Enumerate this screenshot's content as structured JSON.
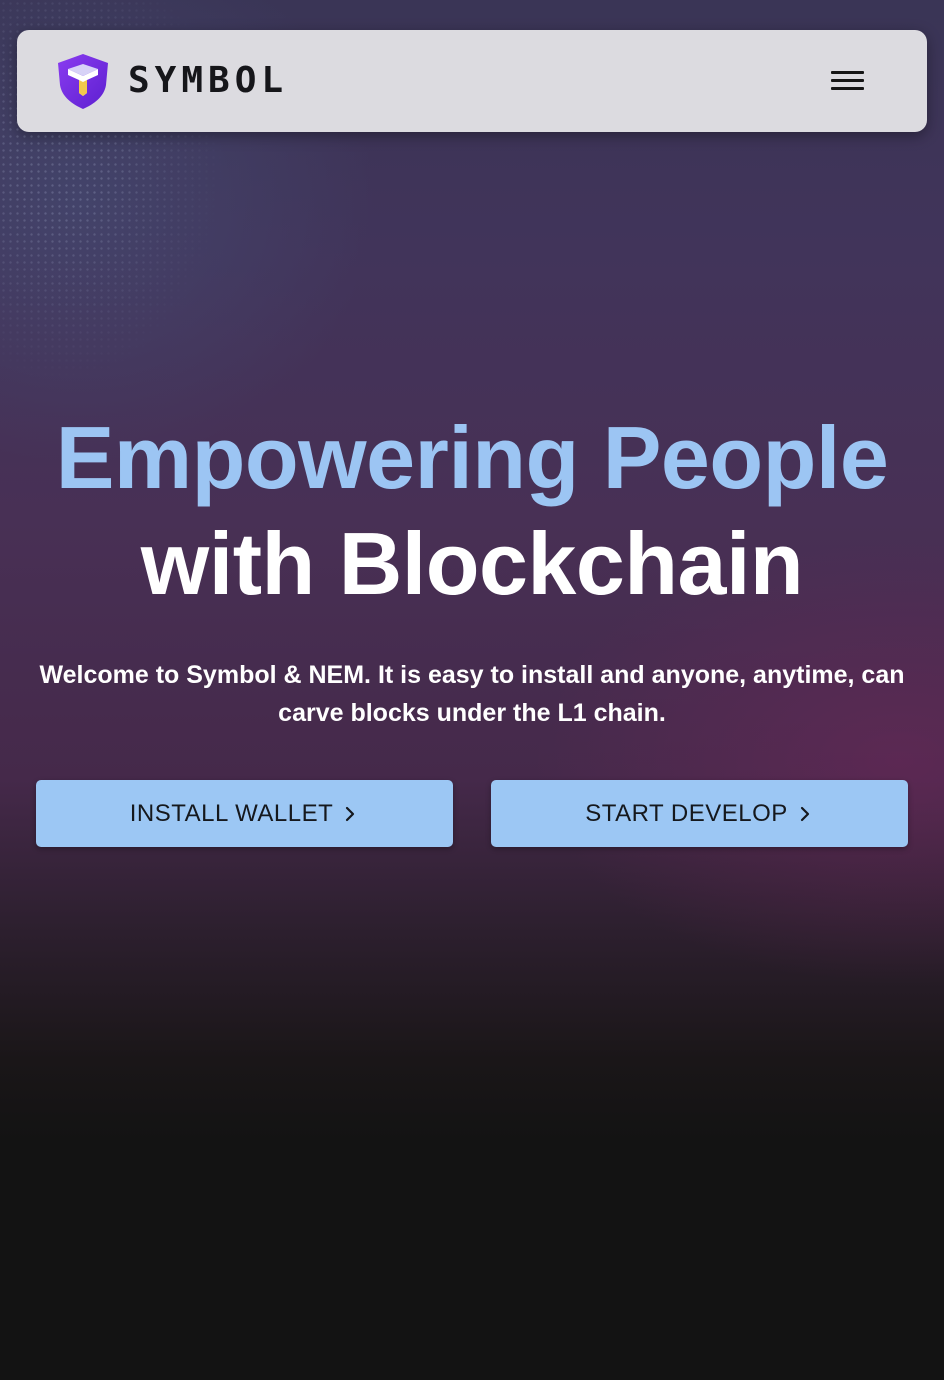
{
  "header": {
    "brand_name": "SYMBOL",
    "brand_logo_icon": "symbol-shield-logo",
    "menu_icon": "hamburger-menu-icon",
    "colors": {
      "bar_background": "#dcdbe0",
      "logo_purple": "#6e2ce0",
      "logo_yellow": "#f2c94c"
    }
  },
  "hero": {
    "title_line1": "Empowering People",
    "title_line2": "with Blockchain",
    "subtitle": "Welcome to Symbol & NEM. It is easy to install and anyone, anytime, can carve blocks under the L1 chain.",
    "colors": {
      "title_accent": "#9cc5f3",
      "title_main": "#ffffff"
    }
  },
  "actions": {
    "install_wallet_label": "INSTALL WALLET",
    "start_develop_label": "START DEVELOP",
    "button_icon": "chevron-right-icon",
    "colors": {
      "button_background": "#9cc7f4",
      "button_text": "#15181d"
    }
  }
}
